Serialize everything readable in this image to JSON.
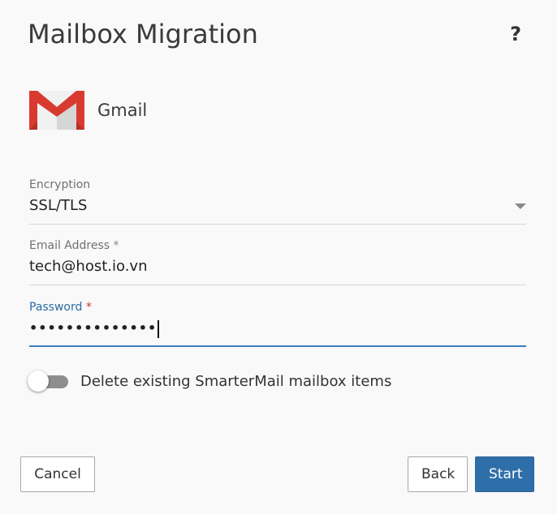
{
  "dialog": {
    "title": "Mailbox Migration",
    "help_label": "?"
  },
  "provider": {
    "name": "Gmail",
    "icon": "gmail-logo-icon"
  },
  "fields": {
    "encryption": {
      "label": "Encryption",
      "value": "SSL/TLS"
    },
    "email": {
      "label": "Email Address",
      "required_mark": "*",
      "value": "tech@host.io.vn"
    },
    "password": {
      "label": "Password",
      "required_mark": "*",
      "value": "••••••••••••••"
    }
  },
  "toggle": {
    "label": "Delete existing SmarterMail mailbox items",
    "state": "off"
  },
  "buttons": {
    "cancel": "Cancel",
    "back": "Back",
    "start": "Start"
  },
  "colors": {
    "accent": "#2f6fa9",
    "focus_underline": "#3a7dc0",
    "required_active": "#c0392b",
    "gmail_red": "#d93a30"
  }
}
